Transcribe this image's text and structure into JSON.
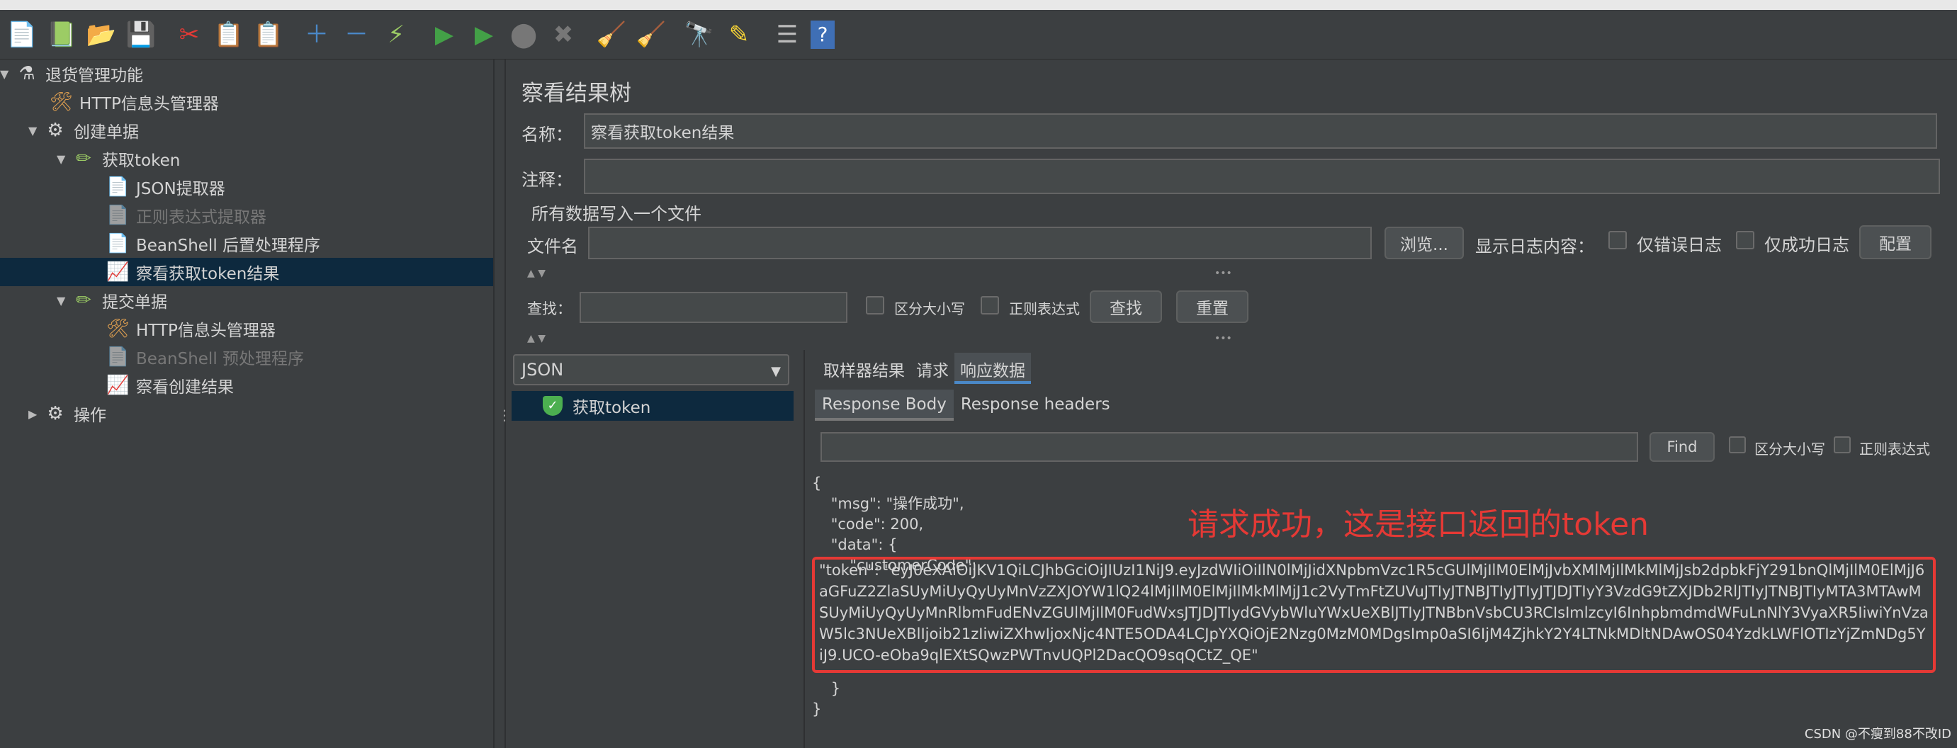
{
  "toolbar": {
    "icons": [
      "new-icon",
      "templates-icon",
      "open-icon",
      "save-icon",
      "cut-icon",
      "copy-icon",
      "paste-icon",
      "expand-icon",
      "collapse-icon",
      "toggle-icon",
      "start-icon",
      "start-no-pause-icon",
      "stop-icon",
      "shutdown-icon",
      "clear-icon",
      "clear-all-icon",
      "search-icon",
      "reset-search-icon",
      "function-helper-icon",
      "help-icon"
    ]
  },
  "tree": {
    "root": "退货管理功能",
    "http_header_1": "HTTP信息头管理器",
    "create_order": "创建单据",
    "get_token": "获取token",
    "json_extractor": "JSON提取器",
    "regex_extractor": "正则表达式提取器",
    "beanshell_post": "BeanShell 后置处理程序",
    "view_token_result": "察看获取token结果",
    "submit_order": "提交单据",
    "http_header_2": "HTTP信息头管理器",
    "beanshell_pre": "BeanShell 预处理程序",
    "view_create_result": "察看创建结果",
    "operation": "操作"
  },
  "panel": {
    "title": "察看结果树",
    "name_label": "名称：",
    "name_value": "察看获取token结果",
    "comment_label": "注释：",
    "comment_value": "",
    "write_all_label": "所有数据写入一个文件",
    "filename_label": "文件名",
    "filename_value": "",
    "browse_button": "浏览...",
    "log_content_label": "显示日志内容：",
    "errors_only": "仅错误日志",
    "success_only": "仅成功日志",
    "config_button": "配置",
    "search_label": "查找：",
    "search_value": "",
    "case_sensitive": "区分大小写",
    "regex": "正则表达式",
    "find_button": "查找",
    "reset_button": "重置"
  },
  "results": {
    "renderer": "JSON",
    "sample": "获取token",
    "tabs": [
      "取样器结果",
      "请求",
      "响应数据"
    ],
    "active_tab": "响应数据",
    "subtabs": [
      "Response Body",
      "Response headers"
    ],
    "active_subtab": "Response Body",
    "find_input": "",
    "find_button": "Find",
    "case_sensitive": "区分大小写",
    "regex": "正则表达式"
  },
  "response": {
    "line_open": "{",
    "line_msg": "    \"msg\": \"操作成功\",",
    "line_code": "    \"code\": 200,",
    "line_data": "    \"data\": {",
    "line_customer": "        \"customerCode\": ",
    "token_text": "        \"token\": \"eyJ0eXAiOiJKV1QiLCJhbGciOiJIUzI1NiJ9.eyJzdWIiOiIlN0lMjJidXNpbmVzc1R5cGUlMjIlM0ElMjJvbXMlMjIlMkMlMjJsb2dpbkFjY291bnQlMjIlM0ElMjJ6aGFuZ2ZlaSUyMiUyQyUyMnVzZXJOYW1lQ24lMjIlM0ElMjIlMkMlMjJ1c2VyTmFtZUVuJTIyJTNBJTIyJTIyJTJDJTIyY3VzdG9tZXJDb2RlJTIyJTNBJTIyMTA3MTAwMSUyMiUyQyUyMnRlbmFudENvZGUlMjIlM0FudWxsJTJDJTIydGVybWluYWxUeXBlJTIyJTNBbnVsbCU3RCIsImlzcyI6InhpbmdmdWFuLnNlY3VyaXR5IiwiYnVzaW5lc3NUeXBlIjoib21zIiwiZXhwIjoxNjc4NTE5ODA4LCJpYXQiOjE2Nzg0MzM0MDgsImp0aSI6IjM4ZjhkY2Y4LTNkMDltNDAwOS04YzdkLWFlOTIzYjZmNDg5YiJ9.UCO-eOba9qlEXtSQwzPWTnvUQPl2DacQO9sqQCtZ_QE\"",
    "line_close_inner": "    }",
    "line_close": "}"
  },
  "annotation": "请求成功，这是接口返回的token",
  "watermark": "CSDN @不瘦到88不改ID",
  "colors": {
    "background": "#3c3f41",
    "selection": "#0d293e",
    "annotation": "#e53935",
    "tab_accent": "#4a88c7"
  }
}
